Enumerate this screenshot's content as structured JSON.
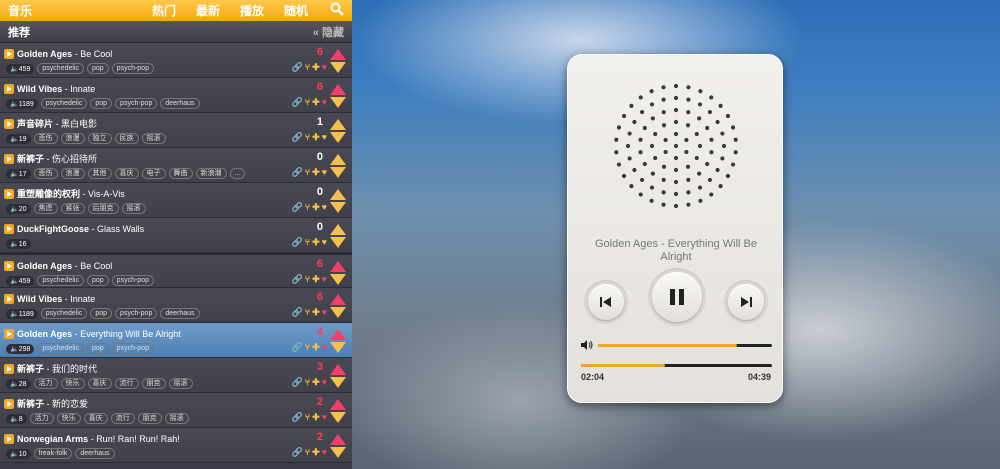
{
  "topbar": {
    "brand": "音乐",
    "nav": [
      "热门",
      "最新",
      "播放",
      "随机"
    ],
    "search_icon": "search-icon"
  },
  "section": {
    "title": "推荐",
    "hide_label": "« 隐藏"
  },
  "tracks": [
    {
      "artist": "Golden Ages",
      "song": "Be Cool",
      "plays": "459",
      "tags": [
        "psychedelic",
        "pop",
        "psych-pop"
      ],
      "score": "6"
    },
    {
      "artist": "Wild Vibes",
      "song": "Innate",
      "plays": "1189",
      "tags": [
        "psychedelic",
        "pop",
        "psych-pop",
        "deerhaus"
      ],
      "score": "6"
    },
    {
      "artist": "声音碎片",
      "song": "黑白电影",
      "plays": "19",
      "tags": [
        "悲伤",
        "浪漫",
        "独立",
        "民族",
        "摇滚"
      ],
      "score": "1"
    },
    {
      "artist": "新裤子",
      "song": "伤心招待所",
      "plays": "17",
      "tags": [
        "悲伤",
        "浪漫",
        "其他",
        "喜庆",
        "电子",
        "舞曲",
        "新浪潮",
        "..."
      ],
      "score": "0"
    },
    {
      "artist": "重塑雕像的权利",
      "song": "Vis-A-Vis",
      "plays": "20",
      "tags": [
        "焦虑",
        "紧张",
        "后朋克",
        "摇滚"
      ],
      "score": "0"
    },
    {
      "artist": "DuckFightGoose",
      "song": "Glass Walls",
      "plays": "16",
      "tags": [],
      "score": "0"
    },
    {
      "artist": "Golden Ages",
      "song": "Be Cool",
      "plays": "459",
      "tags": [
        "psychedelic",
        "pop",
        "psych-pop"
      ],
      "score": "6"
    },
    {
      "artist": "Wild Vibes",
      "song": "Innate",
      "plays": "1189",
      "tags": [
        "psychedelic",
        "pop",
        "psych-pop",
        "deerhaus"
      ],
      "score": "6"
    },
    {
      "artist": "Golden Ages",
      "song": "Everything Will Be Alright",
      "plays": "298",
      "tags": [
        "psychedelic",
        "pop",
        "psych-pop"
      ],
      "score": "4"
    },
    {
      "artist": "新裤子",
      "song": "我们的时代",
      "plays": "28",
      "tags": [
        "活力",
        "快乐",
        "喜庆",
        "流行",
        "朋克",
        "摇滚"
      ],
      "score": "3"
    },
    {
      "artist": "新裤子",
      "song": "新的恋爱",
      "plays": "8",
      "tags": [
        "活力",
        "快乐",
        "喜庆",
        "流行",
        "朋克",
        "摇滚"
      ],
      "score": "2"
    },
    {
      "artist": "Norwegian Arms",
      "song": "Run! Ran! Run! Rah!",
      "plays": "10",
      "tags": [
        "freak-folk",
        "deerhaus"
      ],
      "score": "2"
    }
  ],
  "player": {
    "now_playing": "Golden Ages - Everything Will Be Alright",
    "elapsed": "02:04",
    "duration": "04:39",
    "progress": 0.44,
    "volume": 0.8
  },
  "colors": {
    "accent": "#f5a623",
    "hot": "#f0406a",
    "active_row": "#5a8bbe"
  }
}
